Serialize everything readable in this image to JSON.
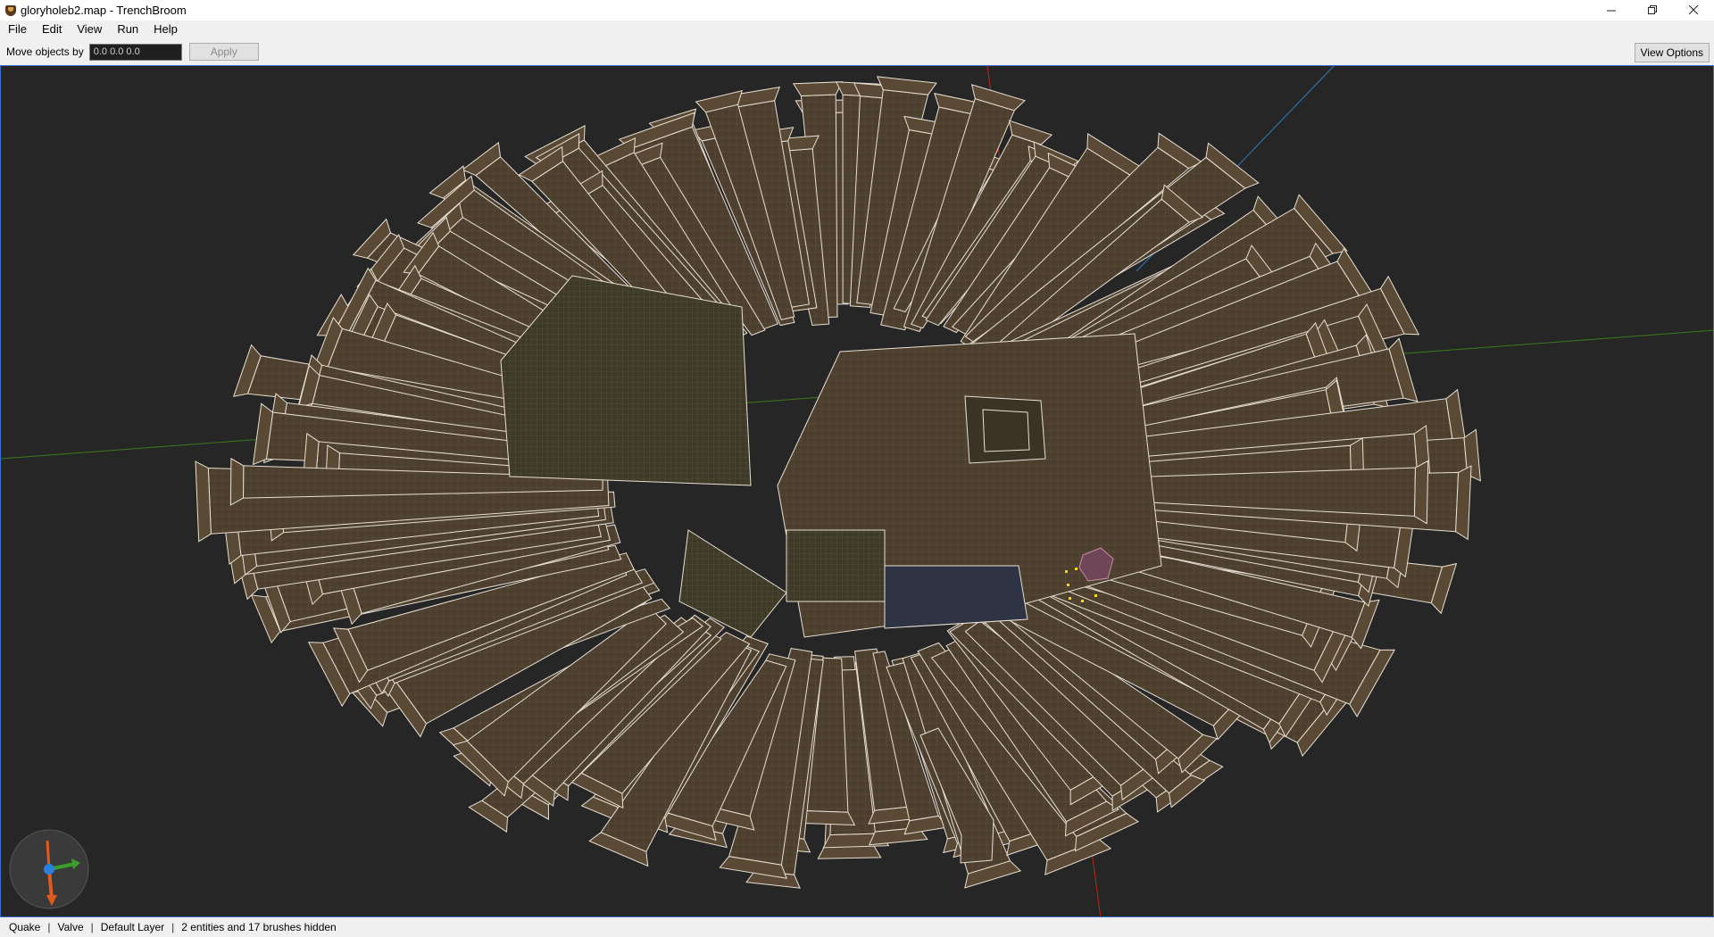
{
  "window": {
    "title": "gloryholeb2.map - TrenchBroom",
    "controls": [
      "minimize-icon",
      "restore-icon",
      "close-icon"
    ]
  },
  "menu": {
    "items": [
      "File",
      "Edit",
      "View",
      "Run",
      "Help"
    ]
  },
  "toolbar": {
    "move_label": "Move objects by",
    "move_value": "0.0 0.0 0.0",
    "apply_label": "Apply",
    "view_options_label": "View Options"
  },
  "viewport": {
    "mode": "3D perspective",
    "background": "#262626",
    "axis_colors": {
      "x": "#b52a1c",
      "y": "#3a7a1e",
      "z": "#2a7fbf"
    },
    "brush_color": "#5a4a35",
    "brush_edge_color": "#e8e0d4",
    "selection_color": "#ffd700"
  },
  "status": {
    "game": "Quake",
    "format": "Valve",
    "layer": "Default Layer",
    "hidden": "2 entities and 17 brushes hidden"
  }
}
